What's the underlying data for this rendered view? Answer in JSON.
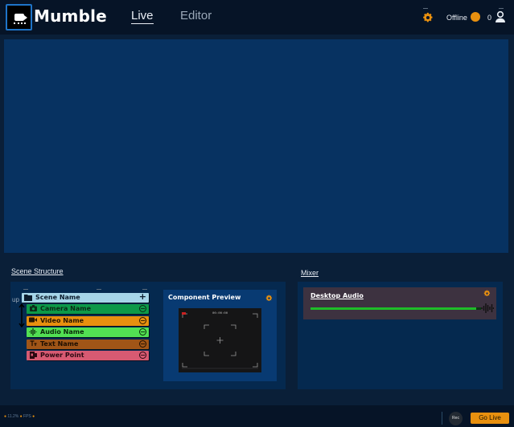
{
  "header": {
    "app_title": "Mumble",
    "tabs": [
      {
        "label": "Live",
        "active": true
      },
      {
        "label": "Editor",
        "active": false
      }
    ],
    "status": "Offline",
    "status_color": "#e8900f",
    "viewer_count": "0"
  },
  "scene_structure": {
    "title": "Scene Structure",
    "up_label": "up",
    "items": [
      {
        "label": "Scene Name",
        "icon": "folder-icon",
        "color": "#a6d5e8"
      },
      {
        "label": "Camera Name",
        "icon": "camera-icon",
        "color": "#0d9948"
      },
      {
        "label": "Video Name",
        "icon": "video-icon",
        "color": "#e8900f"
      },
      {
        "label": "Audio Name",
        "icon": "audio-icon",
        "color": "#52e053"
      },
      {
        "label": "Text Name",
        "icon": "text-icon",
        "color": "#a05517"
      },
      {
        "label": "Power Point",
        "icon": "presentation-icon",
        "color": "#d75a72"
      }
    ]
  },
  "component_preview": {
    "title": "Component Preview",
    "time": "00:00:00"
  },
  "mixer": {
    "title": "Mixer",
    "items": [
      {
        "label": "Desktop Audio",
        "level": 0.97
      }
    ]
  },
  "footer": {
    "cpu": "11.2%",
    "fps": "FPS",
    "rec_label": "Rec",
    "go_live_label": "Go Live"
  },
  "colors": {
    "accent": "#e8900f",
    "background": "#0a1f38",
    "panel": "#05294f",
    "preview": "#073261"
  }
}
